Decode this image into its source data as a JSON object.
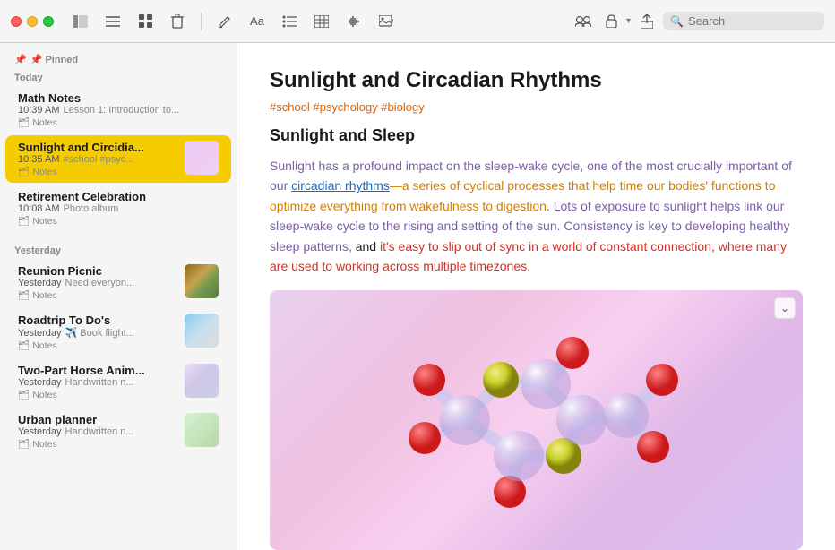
{
  "titlebar": {
    "traffic": [
      "close",
      "minimize",
      "maximize"
    ],
    "toolbar_icons": [
      "sidebar",
      "list",
      "grid",
      "trash",
      "compose",
      "format",
      "bullet-list",
      "table",
      "waveform",
      "image",
      "share",
      "collaborate",
      "lock",
      "export"
    ],
    "search_placeholder": "Search"
  },
  "sidebar": {
    "pinned_label": "📌 Pinned",
    "today_label": "Today",
    "yesterday_label": "Yesterday",
    "notes": [
      {
        "id": "math",
        "title": "Math Notes",
        "time": "10:39 AM",
        "desc": "Lesson 1: Introduction to...",
        "folder": "Notes",
        "active": false,
        "has_thumb": false,
        "section": "today"
      },
      {
        "id": "sunlight",
        "title": "Sunlight and Circidia...",
        "time": "10:35 AM",
        "desc": "#school #psyc...",
        "folder": "Notes",
        "active": true,
        "has_thumb": true,
        "thumb_class": "thumb-sunlight",
        "section": "today"
      },
      {
        "id": "retirement",
        "title": "Retirement Celebration",
        "time": "10:08 AM",
        "desc": "Photo album",
        "folder": "Notes",
        "active": false,
        "has_thumb": false,
        "section": "today"
      },
      {
        "id": "reunion",
        "title": "Reunion Picnic",
        "time": "Yesterday",
        "desc": "Need everyon...",
        "folder": "Notes",
        "active": false,
        "has_thumb": true,
        "thumb_class": "thumb-reunion",
        "section": "yesterday"
      },
      {
        "id": "roadtrip",
        "title": "Roadtrip To Do's",
        "time": "Yesterday",
        "desc": "✈️ Book flight...",
        "folder": "Notes",
        "active": false,
        "has_thumb": true,
        "thumb_class": "thumb-roadtrip",
        "section": "yesterday"
      },
      {
        "id": "horse",
        "title": "Two-Part Horse Anim...",
        "time": "Yesterday",
        "desc": "Handwritten n...",
        "folder": "Notes",
        "active": false,
        "has_thumb": true,
        "thumb_class": "thumb-horse",
        "section": "yesterday"
      },
      {
        "id": "urban",
        "title": "Urban planner",
        "time": "Yesterday",
        "desc": "Handwritten n...",
        "folder": "Notes",
        "active": false,
        "has_thumb": true,
        "thumb_class": "thumb-urban",
        "section": "yesterday"
      }
    ]
  },
  "note": {
    "title": "Sunlight and Circadian Rhythms",
    "tags": "#school #psychology #biology",
    "subtitle": "Sunlight and Sleep",
    "body_parts": [
      {
        "text": "Sunlight has a profound impact on the sleep-wake cycle, one of the most crucially important of our ",
        "style": "purple"
      },
      {
        "text": "circadian rhythms",
        "style": "blue-link"
      },
      {
        "text": "—a series of cyclical processes that help time our bodies' functions to optimize everything from wakefulness to digestion",
        "style": "orange"
      },
      {
        "text": ". Lots of exposure to sunlight helps link our sleep-wake cycle to the rising and setting of the sun. ",
        "style": "normal"
      },
      {
        "text": "Consistency is key to developing healthy sleep patterns,",
        "style": "purple"
      },
      {
        "text": " and ",
        "style": "normal"
      },
      {
        "text": "it's easy to slip out of sync in a world of constant connection, where many are used to working across multiple timezones.",
        "style": "red"
      }
    ],
    "image_expand_label": "⌄"
  }
}
